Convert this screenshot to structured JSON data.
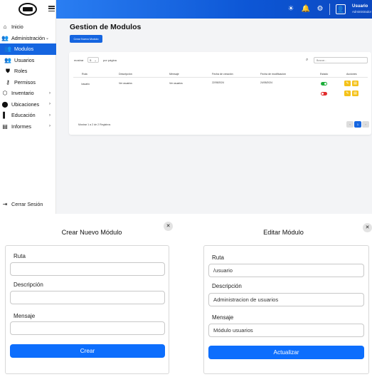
{
  "sidebar": {
    "items": [
      {
        "label": "Inicio",
        "icon": "home-icon"
      },
      {
        "label": "Administración",
        "icon": "users-icon"
      },
      {
        "label": "Modulos",
        "icon": "users-icon"
      },
      {
        "label": "Usuarios",
        "icon": "users-icon"
      },
      {
        "label": "Roles",
        "icon": "shield-icon"
      },
      {
        "label": "Permisos",
        "icon": "key-icon"
      },
      {
        "label": "Inventario",
        "icon": "box-icon"
      },
      {
        "label": "Ubicaciones",
        "icon": "location-icon"
      },
      {
        "label": "Educación",
        "icon": "book-icon"
      },
      {
        "label": "Informes",
        "icon": "document-icon"
      }
    ],
    "logout": "Cerrar Sesión"
  },
  "topbar": {
    "user_name": "Usuario",
    "user_role": "Administrador",
    "accent": "#1565e0"
  },
  "page": {
    "title": "Gestion de Modulos",
    "create_button": "Crear Nuevo Modulo"
  },
  "table": {
    "length_label": "mostrar",
    "length_value": "5",
    "length_suffix": "por página",
    "search_placeholder": "Buscar...",
    "headers": [
      "Ruta",
      "Descripción",
      "Mensaje",
      "Fecha de creación",
      "Fecha de modificación",
      "Estado",
      "Acciones"
    ],
    "rows": [
      {
        "ruta": "/usuario",
        "descripcion": "Ver usuarios",
        "mensaje": "Ver usuarios",
        "creacion": "22/05/2024",
        "modificacion": "24/05/2024",
        "estado": "on"
      },
      {
        "ruta": "",
        "descripcion": "",
        "mensaje": "",
        "creacion": "",
        "modificacion": "",
        "estado": "off"
      }
    ],
    "info": "Mostrar 1 a 2 de 2 Registros",
    "page_current": "1",
    "prev": "‹",
    "next": "›"
  },
  "modal_create": {
    "title": "Crear Nuevo Módulo",
    "ruta_label": "Ruta",
    "ruta_value": "",
    "descripcion_label": "Descripción",
    "descripcion_value": "",
    "mensaje_label": "Mensaje",
    "mensaje_value": "",
    "submit": "Crear"
  },
  "modal_edit": {
    "title": "Editar Módulo",
    "ruta_label": "Ruta",
    "ruta_value": "/usuario",
    "descripcion_label": "Descripción",
    "descripcion_value": "Administracion de usuarios",
    "mensaje_label": "Mensaje",
    "mensaje_value": "Módulo usuarios",
    "submit": "Actualizar"
  }
}
